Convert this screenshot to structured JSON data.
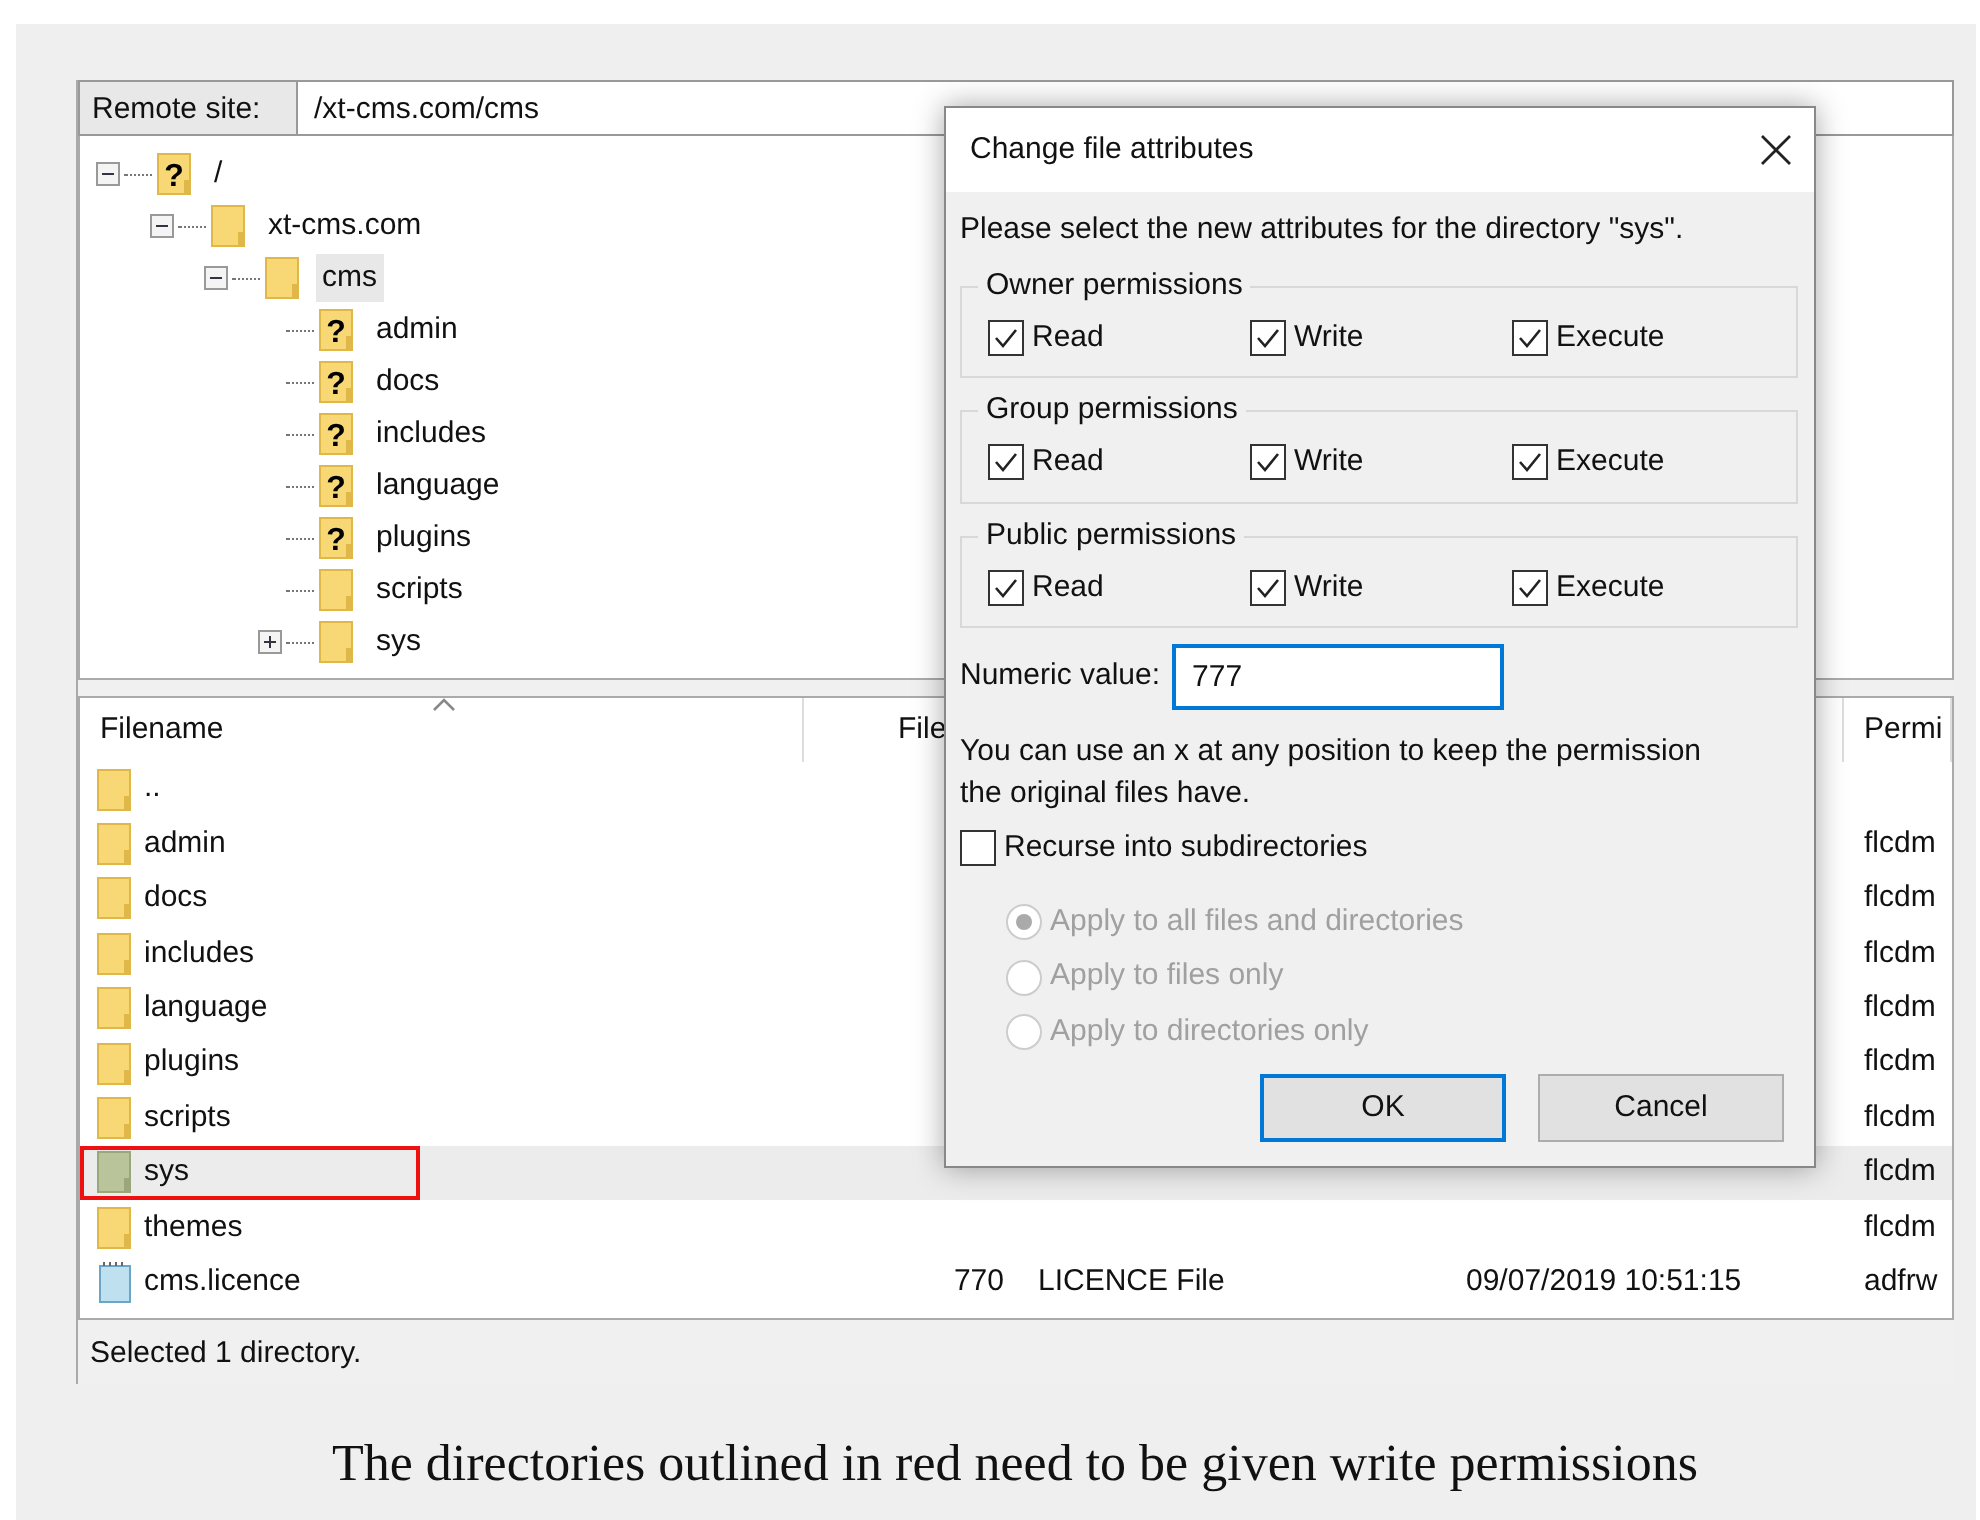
{
  "remote_site": {
    "label": "Remote site:",
    "path": "/xt-cms.com/cms"
  },
  "tree": [
    {
      "label": "/",
      "icon_mark": "?",
      "expanded": true,
      "selected": false,
      "children": [
        {
          "label": "xt-cms.com",
          "expanded": true,
          "selected": false,
          "children": [
            {
              "label": "cms",
              "expanded": true,
              "selected": true,
              "children": [
                {
                  "label": "admin",
                  "icon_mark": "?",
                  "selected": false
                },
                {
                  "label": "docs",
                  "icon_mark": "?",
                  "selected": false
                },
                {
                  "label": "includes",
                  "icon_mark": "?",
                  "selected": false
                },
                {
                  "label": "language",
                  "icon_mark": "?",
                  "selected": false
                },
                {
                  "label": "plugins",
                  "icon_mark": "?",
                  "selected": false
                },
                {
                  "label": "scripts",
                  "selected": false
                },
                {
                  "label": "sys",
                  "expanded": false,
                  "selected": false
                }
              ]
            }
          ]
        }
      ]
    }
  ],
  "file_list": {
    "columns": [
      {
        "label": "Filename"
      },
      {
        "label": "File"
      },
      {
        "label": "Permi"
      }
    ],
    "rows": [
      {
        "kind": "folder",
        "name": "..",
        "selected": false,
        "outlined": false
      },
      {
        "kind": "folder",
        "name": "admin",
        "permissions": "flcdm",
        "selected": false,
        "outlined": false
      },
      {
        "kind": "folder",
        "name": "docs",
        "permissions": "flcdm",
        "selected": false,
        "outlined": false
      },
      {
        "kind": "folder",
        "name": "includes",
        "permissions": "flcdm",
        "selected": false,
        "outlined": false
      },
      {
        "kind": "folder",
        "name": "language",
        "permissions": "flcdm",
        "selected": false,
        "outlined": false
      },
      {
        "kind": "folder",
        "name": "plugins",
        "permissions": "flcdm",
        "selected": false,
        "outlined": false
      },
      {
        "kind": "folder",
        "name": "scripts",
        "permissions": "flcdm",
        "selected": false,
        "outlined": false
      },
      {
        "kind": "folder",
        "name": "sys",
        "permissions": "flcdm",
        "selected": true,
        "outlined": true
      },
      {
        "kind": "folder",
        "name": "themes",
        "permissions": "flcdm",
        "selected": false,
        "outlined": false
      },
      {
        "kind": "file",
        "name": "cms.licence",
        "size": "770",
        "type": "LICENCE File",
        "modified": "09/07/2019 10:51:15",
        "permissions": "adfrw",
        "selected": false,
        "outlined": false
      }
    ]
  },
  "status_bar": "Selected 1 directory.",
  "dialog": {
    "title": "Change file attributes",
    "message": "Please select the new attributes for the directory \"sys\".",
    "groups": [
      {
        "title": "Owner permissions",
        "options": [
          {
            "label": "Read",
            "checked": true
          },
          {
            "label": "Write",
            "checked": true
          },
          {
            "label": "Execute",
            "checked": true
          }
        ]
      },
      {
        "title": "Group permissions",
        "options": [
          {
            "label": "Read",
            "checked": true
          },
          {
            "label": "Write",
            "checked": true
          },
          {
            "label": "Execute",
            "checked": true
          }
        ]
      },
      {
        "title": "Public permissions",
        "options": [
          {
            "label": "Read",
            "checked": true
          },
          {
            "label": "Write",
            "checked": true
          },
          {
            "label": "Execute",
            "checked": true
          }
        ]
      }
    ],
    "numeric": {
      "label": "Numeric value:",
      "value": "777"
    },
    "hint": "You can use an x at any position to keep the permission the original files have.",
    "recurse": {
      "label": "Recurse into subdirectories",
      "checked": false
    },
    "apply_options": [
      {
        "label": "Apply to all files and directories",
        "selected": true,
        "disabled": true
      },
      {
        "label": "Apply to files only",
        "selected": false,
        "disabled": true
      },
      {
        "label": "Apply to directories only",
        "selected": false,
        "disabled": true
      }
    ],
    "buttons": [
      {
        "label": "OK",
        "default": true
      },
      {
        "label": "Cancel",
        "default": false
      }
    ]
  },
  "caption": "The directories outlined in red need to be given write permissions"
}
